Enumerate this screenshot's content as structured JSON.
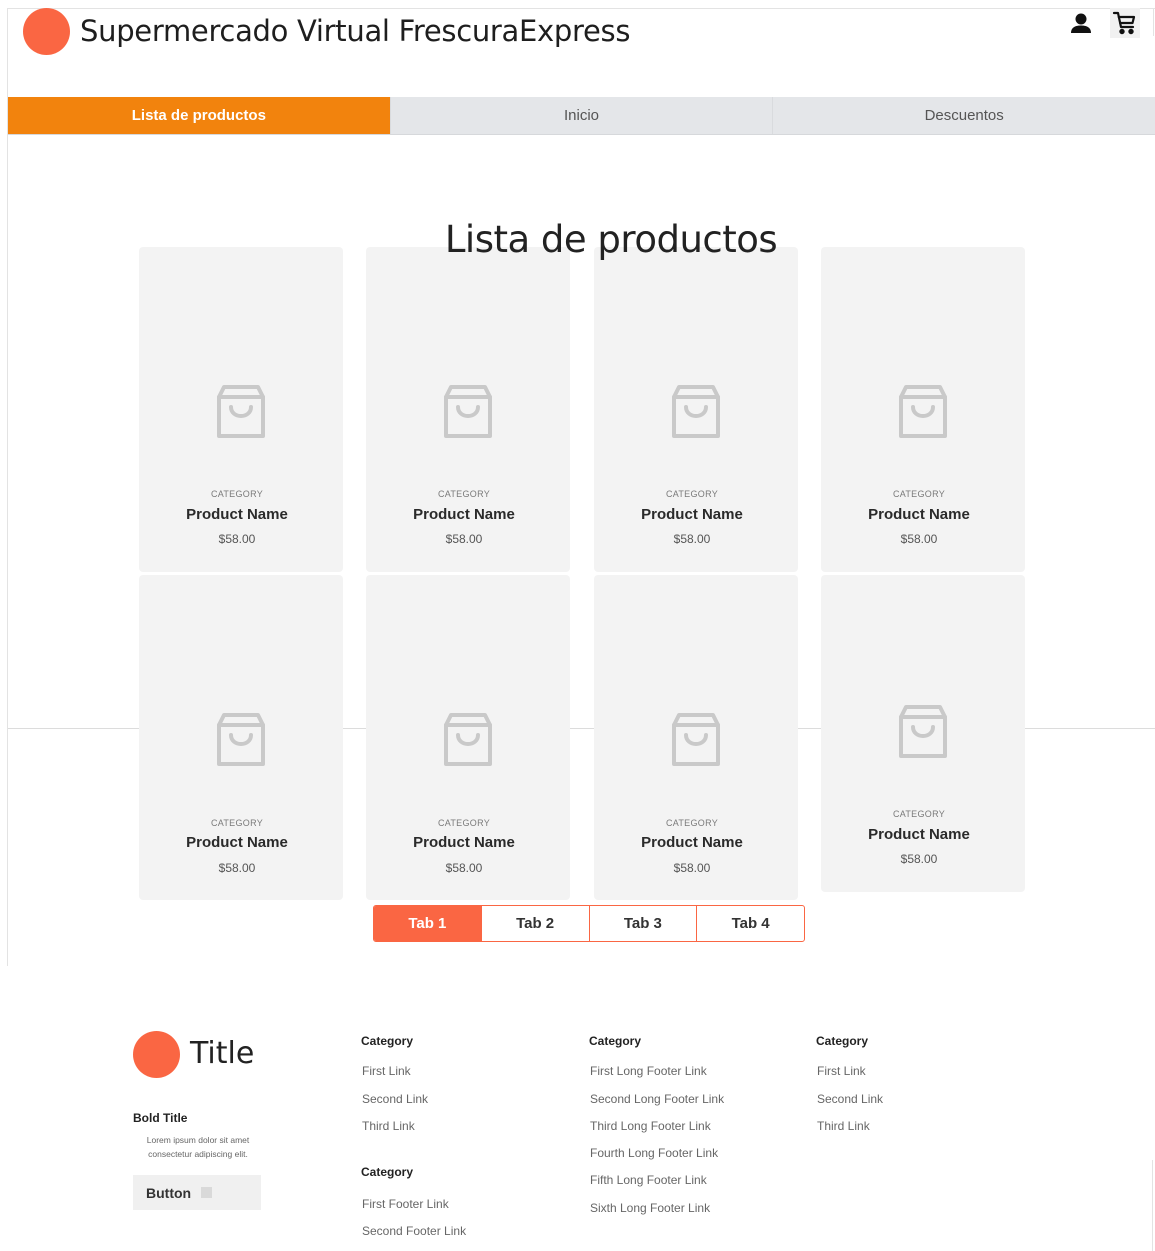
{
  "header": {
    "title": "Supermercado Virtual FrescuraExpress",
    "icons": [
      "user-icon",
      "cart-icon"
    ]
  },
  "nav": {
    "items": [
      {
        "label": "Lista de productos",
        "active": true
      },
      {
        "label": "Inicio",
        "active": false
      },
      {
        "label": "Descuentos",
        "active": false
      }
    ]
  },
  "main": {
    "title": "Lista de productos",
    "products": [
      {
        "category": "CATEGORY",
        "name": "Product Name",
        "price": "$58.00"
      },
      {
        "category": "CATEGORY",
        "name": "Product Name",
        "price": "$58.00"
      },
      {
        "category": "CATEGORY",
        "name": "Product Name",
        "price": "$58.00"
      },
      {
        "category": "CATEGORY",
        "name": "Product Name",
        "price": "$58.00"
      },
      {
        "category": "CATEGORY",
        "name": "Product Name",
        "price": "$58.00"
      },
      {
        "category": "CATEGORY",
        "name": "Product Name",
        "price": "$58.00"
      },
      {
        "category": "CATEGORY",
        "name": "Product Name",
        "price": "$58.00"
      },
      {
        "category": "CATEGORY",
        "name": "Product Name",
        "price": "$58.00"
      }
    ],
    "tabs": [
      {
        "label": "Tab 1",
        "active": true
      },
      {
        "label": "Tab 2",
        "active": false
      },
      {
        "label": "Tab 3",
        "active": false
      },
      {
        "label": "Tab 4",
        "active": false
      }
    ]
  },
  "footer": {
    "title": "Title",
    "bold_title": "Bold Title",
    "description": "Lorem ipsum dolor sit amet consectetur adipiscing elit.",
    "button_label": "Button",
    "columns": [
      {
        "category": "Category",
        "links": [
          "First Link",
          "Second Link",
          "Third Link"
        ]
      },
      {
        "category": "Category",
        "links": [
          "First Footer Link",
          "Second Footer Link"
        ]
      },
      {
        "category": "Category",
        "links": [
          "First Long Footer Link",
          "Second Long Footer Link",
          "Third Long Footer Link",
          "Fourth Long Footer Link",
          "Fifth Long Footer Link",
          "Sixth Long Footer Link"
        ]
      },
      {
        "category": "Category",
        "links": [
          "First Link",
          "Second Link",
          "Third Link"
        ]
      }
    ]
  },
  "colors": {
    "accent": "#fa6643",
    "nav_active": "#f2830d",
    "card_bg": "#f3f3f3"
  }
}
